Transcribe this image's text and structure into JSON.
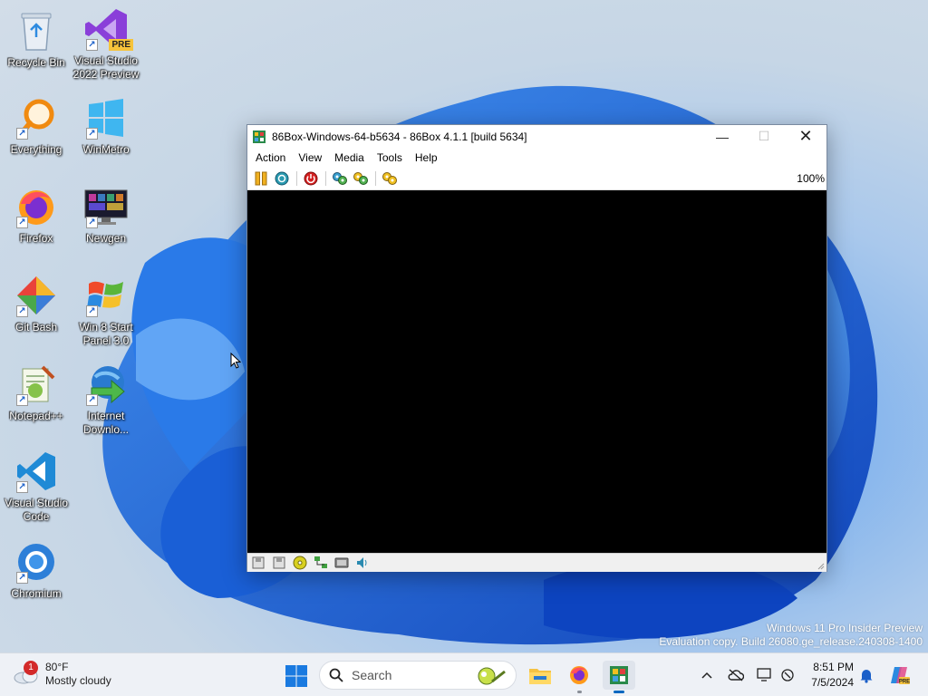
{
  "desktop": {
    "icons": [
      {
        "label": "Recycle Bin"
      },
      {
        "label": "Visual Studio 2022 Preview",
        "line1": "Visual Studio",
        "line2": "2022 Preview",
        "badge": "PRE"
      },
      {
        "label": "Everything"
      },
      {
        "label": "WinMetro"
      },
      {
        "label": "Firefox"
      },
      {
        "label": "Newgen"
      },
      {
        "label": "Git Bash"
      },
      {
        "label": "Win 8 Start Panel 3.0",
        "line1": "Win 8 Start",
        "line2": "Panel 3.0"
      },
      {
        "label": "Notepad++"
      },
      {
        "label": "Internet Downlo...",
        "line1": "Internet",
        "line2": "Downlo..."
      },
      {
        "label": "Visual Studio Code",
        "line1": "Visual Studio",
        "line2": "Code"
      },
      {
        "label": "Chromium"
      }
    ]
  },
  "window": {
    "title": "86Box-Windows-64-b5634 - 86Box 4.1.1 [build 5634]",
    "menu": [
      "Action",
      "View",
      "Media",
      "Tools",
      "Help"
    ],
    "toolbar": {
      "buttons": [
        "pause-icon",
        "ctrl-alt-del-icon",
        "power-icon",
        "settings-icon",
        "hard-reset-icon",
        "ctrl-alt-esc-icon"
      ],
      "zoom": "100%"
    },
    "statusbar": {
      "icons": [
        "floppy-a-icon",
        "floppy-b-icon",
        "cdrom-icon",
        "network-icon",
        "video-icon",
        "sound-icon"
      ]
    }
  },
  "watermark": {
    "line1": "Windows 11 Pro Insider Preview",
    "line2": "Evaluation copy. Build 26080.ge_release.240308-1400"
  },
  "taskbar": {
    "weather": {
      "temp": "80°F",
      "condition": "Mostly cloudy",
      "badge": "1"
    },
    "search_placeholder": "Search",
    "clock": {
      "time": "8:51 PM",
      "date": "7/5/2024"
    },
    "colors": {
      "accent": "#0067c0"
    }
  }
}
